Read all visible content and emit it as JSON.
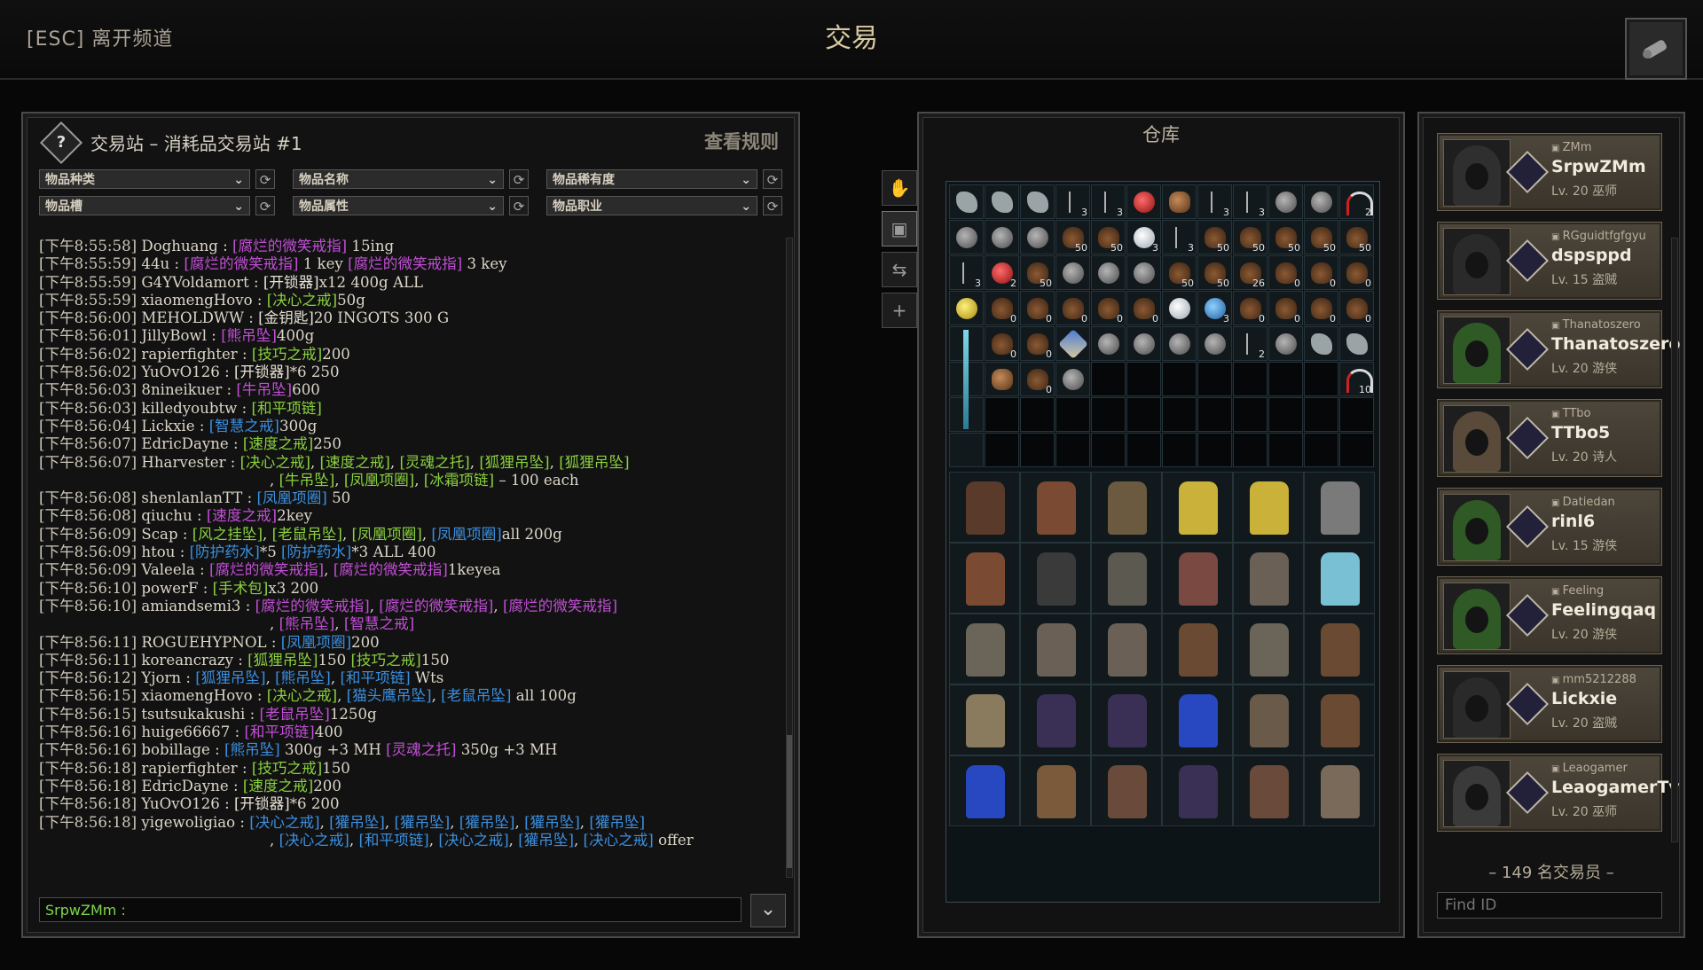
{
  "topbar": {
    "esc_label": "[ESC] 离开频道",
    "title": "交易"
  },
  "chat": {
    "channel": "交易站 – 消耗品交易站 #1",
    "rules_label": "查看规则",
    "filters": [
      "物品种类",
      "物品名称",
      "物品稀有度",
      "物品槽",
      "物品属性",
      "物品职业"
    ],
    "input_user": "SrpwZMm :",
    "messages": [
      [
        [
          "ts",
          "[下午8:55:58] "
        ],
        [
          "t",
          "Doghuang : "
        ],
        [
          "p",
          "[腐烂的微笑戒指]"
        ],
        [
          "t",
          " 15ing"
        ]
      ],
      [
        [
          "ts",
          "[下午8:55:59] "
        ],
        [
          "t",
          "44u : "
        ],
        [
          "p",
          "[腐烂的微笑戒指]"
        ],
        [
          "t",
          " 1 key "
        ],
        [
          "p",
          "[腐烂的微笑戒指]"
        ],
        [
          "t",
          " 3 key"
        ]
      ],
      [
        [
          "ts",
          "[下午8:55:59] "
        ],
        [
          "t",
          "G4YVoldamort : "
        ],
        [
          "w",
          "[开锁器]"
        ],
        [
          "t",
          "x12 400g ALL"
        ]
      ],
      [
        [
          "ts",
          "[下午8:55:59] "
        ],
        [
          "t",
          "xiaomengHovo : "
        ],
        [
          "g",
          "[决心之戒]"
        ],
        [
          "t",
          "50g"
        ]
      ],
      [
        [
          "ts",
          "[下午8:56:00] "
        ],
        [
          "t",
          "MEHOLDWW : "
        ],
        [
          "w",
          "[金钥匙]"
        ],
        [
          "t",
          "20 INGOTS 300 G"
        ]
      ],
      [
        [
          "ts",
          "[下午8:56:01] "
        ],
        [
          "t",
          "JillyBowl : "
        ],
        [
          "p",
          "[熊吊坠]"
        ],
        [
          "t",
          "400g"
        ]
      ],
      [
        [
          "ts",
          "[下午8:56:02] "
        ],
        [
          "t",
          "rapierfighter : "
        ],
        [
          "g",
          "[技巧之戒]"
        ],
        [
          "t",
          "200"
        ]
      ],
      [
        [
          "ts",
          "[下午8:56:02] "
        ],
        [
          "t",
          "YuOvO126 : "
        ],
        [
          "w",
          "[开锁器]"
        ],
        [
          "t",
          "*6 250"
        ]
      ],
      [
        [
          "ts",
          "[下午8:56:03] "
        ],
        [
          "t",
          "8nineikuer : "
        ],
        [
          "p",
          "[牛吊坠]"
        ],
        [
          "t",
          "600"
        ]
      ],
      [
        [
          "ts",
          "[下午8:56:03] "
        ],
        [
          "t",
          "killedyoubtw : "
        ],
        [
          "g",
          "[和平项链]"
        ]
      ],
      [
        [
          "ts",
          "[下午8:56:04] "
        ],
        [
          "t",
          "Lickxie : "
        ],
        [
          "b",
          "[智慧之戒]"
        ],
        [
          "t",
          "300g"
        ]
      ],
      [
        [
          "ts",
          "[下午8:56:07] "
        ],
        [
          "t",
          "EdricDayne : "
        ],
        [
          "g",
          "[速度之戒]"
        ],
        [
          "t",
          "250"
        ]
      ],
      [
        [
          "ts",
          "[下午8:56:07] "
        ],
        [
          "t",
          "Hharvester : "
        ],
        [
          "g",
          "[决心之戒]"
        ],
        [
          "t",
          ", "
        ],
        [
          "g",
          "[速度之戒]"
        ],
        [
          "t",
          ", "
        ],
        [
          "g",
          "[灵魂之托]"
        ],
        [
          "t",
          ", "
        ],
        [
          "g",
          "[狐狸吊坠]"
        ],
        [
          "t",
          ", "
        ],
        [
          "g",
          "[狐狸吊坠]"
        ]
      ],
      [
        [
          "cont",
          ""
        ],
        [
          "t",
          ", "
        ],
        [
          "g",
          "[牛吊坠]"
        ],
        [
          "t",
          ", "
        ],
        [
          "g",
          "[凤凰项圈]"
        ],
        [
          "t",
          ", "
        ],
        [
          "g",
          "[冰霜项链]"
        ],
        [
          "t",
          " – 100 each"
        ]
      ],
      [
        [
          "ts",
          "[下午8:56:08] "
        ],
        [
          "t",
          "shenlanlanTT : "
        ],
        [
          "b",
          "[凤凰项圈]"
        ],
        [
          "t",
          " 50"
        ]
      ],
      [
        [
          "ts",
          "[下午8:56:08] "
        ],
        [
          "t",
          "qiuchu : "
        ],
        [
          "p",
          "[速度之戒]"
        ],
        [
          "t",
          "2key"
        ]
      ],
      [
        [
          "ts",
          "[下午8:56:09] "
        ],
        [
          "t",
          "Scap : "
        ],
        [
          "g",
          "[风之挂坠]"
        ],
        [
          "t",
          ", "
        ],
        [
          "g",
          "[老鼠吊坠]"
        ],
        [
          "t",
          ", "
        ],
        [
          "g",
          "[凤凰项圈]"
        ],
        [
          "t",
          ", "
        ],
        [
          "b",
          "[凤凰项圈]"
        ],
        [
          "t",
          "all 200g"
        ]
      ],
      [
        [
          "ts",
          "[下午8:56:09] "
        ],
        [
          "t",
          "htou : "
        ],
        [
          "b",
          "[防护药水]"
        ],
        [
          "t",
          "*5 "
        ],
        [
          "b",
          "[防护药水]"
        ],
        [
          "t",
          "*3 ALL 400"
        ]
      ],
      [
        [
          "ts",
          "[下午8:56:09] "
        ],
        [
          "t",
          "Valeela : "
        ],
        [
          "p",
          "[腐烂的微笑戒指]"
        ],
        [
          "t",
          ", "
        ],
        [
          "p",
          "[腐烂的微笑戒指]"
        ],
        [
          "t",
          "1keyea"
        ]
      ],
      [
        [
          "ts",
          "[下午8:56:10] "
        ],
        [
          "t",
          "powerF : "
        ],
        [
          "g",
          "[手术包]"
        ],
        [
          "t",
          "x3 200"
        ]
      ],
      [
        [
          "ts",
          "[下午8:56:10] "
        ],
        [
          "t",
          "amiandsemi3 : "
        ],
        [
          "p",
          "[腐烂的微笑戒指]"
        ],
        [
          "t",
          ", "
        ],
        [
          "p",
          "[腐烂的微笑戒指]"
        ],
        [
          "t",
          ", "
        ],
        [
          "p",
          "[腐烂的微笑戒指]"
        ]
      ],
      [
        [
          "cont",
          ""
        ],
        [
          "t",
          ", "
        ],
        [
          "p",
          "[熊吊坠]"
        ],
        [
          "t",
          ", "
        ],
        [
          "p",
          "[智慧之戒]"
        ]
      ],
      [
        [
          "ts",
          "[下午8:56:11] "
        ],
        [
          "t",
          "ROGUEHYPNOL : "
        ],
        [
          "b",
          "[凤凰项圈]"
        ],
        [
          "t",
          "200"
        ]
      ],
      [
        [
          "ts",
          "[下午8:56:11] "
        ],
        [
          "t",
          "koreancrazy : "
        ],
        [
          "g",
          "[狐狸吊坠]"
        ],
        [
          "t",
          "150 "
        ],
        [
          "g",
          "[技巧之戒]"
        ],
        [
          "t",
          "150"
        ]
      ],
      [
        [
          "ts",
          "[下午8:56:12] "
        ],
        [
          "t",
          "Yjorn : "
        ],
        [
          "b",
          "[狐狸吊坠]"
        ],
        [
          "t",
          ", "
        ],
        [
          "b",
          "[熊吊坠]"
        ],
        [
          "t",
          ", "
        ],
        [
          "b",
          "[和平项链]"
        ],
        [
          "t",
          " Wts"
        ]
      ],
      [
        [
          "ts",
          "[下午8:56:15] "
        ],
        [
          "t",
          "xiaomengHovo : "
        ],
        [
          "g",
          "[决心之戒]"
        ],
        [
          "t",
          ", "
        ],
        [
          "b",
          "[猫头鹰吊坠]"
        ],
        [
          "t",
          ", "
        ],
        [
          "b",
          "[老鼠吊坠]"
        ],
        [
          "t",
          " all 100g"
        ]
      ],
      [
        [
          "ts",
          "[下午8:56:15] "
        ],
        [
          "t",
          "tsutsukakushi : "
        ],
        [
          "p",
          "[老鼠吊坠]"
        ],
        [
          "t",
          "1250g"
        ]
      ],
      [
        [
          "ts",
          "[下午8:56:16] "
        ],
        [
          "t",
          "huige66667 : "
        ],
        [
          "p",
          "[和平项链]"
        ],
        [
          "t",
          "400"
        ]
      ],
      [
        [
          "ts",
          "[下午8:56:16] "
        ],
        [
          "t",
          "bobillage : "
        ],
        [
          "b",
          "[熊吊坠]"
        ],
        [
          "t",
          " 300g +3 MH "
        ],
        [
          "p",
          "[灵魂之托]"
        ],
        [
          "t",
          " 350g +3 MH"
        ]
      ],
      [
        [
          "ts",
          "[下午8:56:18] "
        ],
        [
          "t",
          "rapierfighter : "
        ],
        [
          "g",
          "[技巧之戒]"
        ],
        [
          "t",
          "150"
        ]
      ],
      [
        [
          "ts",
          "[下午8:56:18] "
        ],
        [
          "t",
          "EdricDayne : "
        ],
        [
          "g",
          "[速度之戒]"
        ],
        [
          "t",
          "200"
        ]
      ],
      [
        [
          "ts",
          "[下午8:56:18] "
        ],
        [
          "t",
          "YuOvO126 : "
        ],
        [
          "w",
          "[开锁器]"
        ],
        [
          "t",
          "*6 200"
        ]
      ],
      [
        [
          "ts",
          "[下午8:56:18] "
        ],
        [
          "t",
          "yigewoligiao : "
        ],
        [
          "b",
          "[决心之戒]"
        ],
        [
          "t",
          ", "
        ],
        [
          "b",
          "[獾吊坠]"
        ],
        [
          "t",
          ", "
        ],
        [
          "b",
          "[獾吊坠]"
        ],
        [
          "t",
          ", "
        ],
        [
          "b",
          "[獾吊坠]"
        ],
        [
          "t",
          ", "
        ],
        [
          "b",
          "[獾吊坠]"
        ],
        [
          "t",
          ", "
        ],
        [
          "b",
          "[獾吊坠]"
        ]
      ],
      [
        [
          "cont",
          ""
        ],
        [
          "t",
          ", "
        ],
        [
          "b",
          "[决心之戒]"
        ],
        [
          "t",
          ", "
        ],
        [
          "b",
          "[和平项链]"
        ],
        [
          "t",
          ", "
        ],
        [
          "b",
          "[决心之戒]"
        ],
        [
          "t",
          ", "
        ],
        [
          "b",
          "[獾吊坠]"
        ],
        [
          "t",
          ", "
        ],
        [
          "b",
          "[决心之戒]"
        ],
        [
          "t",
          " offer"
        ]
      ]
    ]
  },
  "warehouse": {
    "title": "仓库",
    "grid_rows": [
      [
        [
          "bandage",
          ""
        ],
        [
          "bandage",
          ""
        ],
        [
          "bandage",
          ""
        ],
        [
          "lockpick",
          "3"
        ],
        [
          "lockpick",
          "3"
        ],
        [
          "potion-red",
          ""
        ],
        [
          "bread",
          ""
        ],
        [
          "lockpick",
          "3"
        ],
        [
          "lockpick",
          "3"
        ],
        [
          "coin",
          ""
        ],
        [
          "coin",
          ""
        ],
        [
          "candy",
          "2"
        ]
      ],
      [
        [
          "coin",
          ""
        ],
        [
          "coin",
          ""
        ],
        [
          "coin",
          ""
        ],
        [
          "bag",
          "50"
        ],
        [
          "bag",
          "50"
        ],
        [
          "potion-white",
          "3"
        ],
        [
          "lockpick",
          "3"
        ],
        [
          "bag",
          "50"
        ],
        [
          "bag",
          "50"
        ],
        [
          "bag",
          "50"
        ],
        [
          "bag",
          "50"
        ],
        [
          "bag",
          "50"
        ]
      ],
      [
        [
          "lockpick",
          "3"
        ],
        [
          "potion-red",
          "2"
        ],
        [
          "bag",
          "50"
        ],
        [
          "coin",
          ""
        ],
        [
          "coin",
          ""
        ],
        [
          "coin",
          ""
        ],
        [
          "bag",
          "50"
        ],
        [
          "bag",
          "50"
        ],
        [
          "bag",
          "26"
        ],
        [
          "bag",
          "0"
        ],
        [
          "bag",
          "0"
        ],
        [
          "bag",
          "0"
        ]
      ],
      [
        [
          "potion-yellow",
          ""
        ],
        [
          "bag",
          "0"
        ],
        [
          "bag",
          "0"
        ],
        [
          "bag",
          "0"
        ],
        [
          "bag",
          "0"
        ],
        [
          "bag",
          "0"
        ],
        [
          "potion-white",
          ""
        ],
        [
          "potion-blue",
          "3"
        ],
        [
          "bag",
          "0"
        ],
        [
          "bag",
          "0"
        ],
        [
          "bag",
          "0"
        ],
        [
          "bag",
          "0"
        ]
      ],
      [
        [
          "",
          ""
        ],
        [
          "bag",
          "0"
        ],
        [
          "bag",
          "0"
        ],
        [
          "gem",
          ""
        ],
        [
          "coin",
          ""
        ],
        [
          "coin",
          ""
        ],
        [
          "coin",
          ""
        ],
        [
          "coin",
          ""
        ],
        [
          "lockpick",
          "2"
        ],
        [
          "coin",
          ""
        ],
        [
          "bandage",
          ""
        ],
        [
          "bandage",
          ""
        ]
      ],
      [
        [
          "",
          ""
        ],
        [
          "bread",
          ""
        ],
        [
          "bag",
          "0"
        ],
        [
          "coin",
          ""
        ],
        [
          "dark",
          ""
        ],
        [
          "dark",
          ""
        ],
        [
          "dark",
          ""
        ],
        [
          "dark",
          ""
        ],
        [
          "dark",
          ""
        ],
        [
          "dark",
          ""
        ],
        [
          "dark",
          ""
        ],
        [
          "candy",
          "10"
        ]
      ],
      [
        [
          "",
          ""
        ],
        [
          "dark",
          ""
        ],
        [
          "dark",
          ""
        ],
        [
          "dark",
          ""
        ],
        [
          "dark",
          ""
        ],
        [
          "dark",
          ""
        ],
        [
          "dark",
          ""
        ],
        [
          "dark",
          ""
        ],
        [
          "dark",
          ""
        ],
        [
          "dark",
          ""
        ],
        [
          "dark",
          ""
        ],
        [
          "dark",
          ""
        ]
      ],
      [
        [
          "",
          ""
        ],
        [
          "dark",
          ""
        ],
        [
          "dark",
          ""
        ],
        [
          "dark",
          ""
        ],
        [
          "dark",
          ""
        ],
        [
          "dark",
          ""
        ],
        [
          "dark",
          ""
        ],
        [
          "dark",
          ""
        ],
        [
          "dark",
          ""
        ],
        [
          "dark",
          ""
        ],
        [
          "dark",
          ""
        ],
        [
          "dark",
          ""
        ]
      ]
    ]
  },
  "traders": {
    "list": [
      {
        "acct": "ZMm",
        "name": "SrpwZMm",
        "level": "Lv. 20 巫师",
        "hood": "#2f2f2f"
      },
      {
        "acct": "RGguidtfgfgyu",
        "name": "dspsppd",
        "level": "Lv. 15 盗贼",
        "hood": "#2a2a2a"
      },
      {
        "acct": "Thanatoszero",
        "name": "Thanatoszero",
        "level": "Lv. 20 游侠",
        "hood": "#2f5a25"
      },
      {
        "acct": "TTbo",
        "name": "TTbo5",
        "level": "Lv. 20 诗人",
        "hood": "#5a4a3a"
      },
      {
        "acct": "Datiedan",
        "name": "rinl6",
        "level": "Lv. 15 游侠",
        "hood": "#2f5a25"
      },
      {
        "acct": "Feeling",
        "name": "Feelingqaq",
        "level": "Lv. 20 游侠",
        "hood": "#2f5a25"
      },
      {
        "acct": "mm5212288",
        "name": "Lickxie",
        "level": "Lv. 20 盗贼",
        "hood": "#2a2a2a"
      },
      {
        "acct": "Leaogamer",
        "name": "LeaogamerTv",
        "level": "Lv. 20 巫师",
        "hood": "#3a3a3a"
      }
    ],
    "count_label": "– 149 名交易员 –",
    "find_placeholder": "Find ID"
  },
  "colors": {
    "rare_purple": "#c24fd6",
    "rare_blue": "#3b8fe0",
    "rare_green": "#8ad13e",
    "self_name": "#7bd64a",
    "gold_title": "#d9c9a3"
  }
}
